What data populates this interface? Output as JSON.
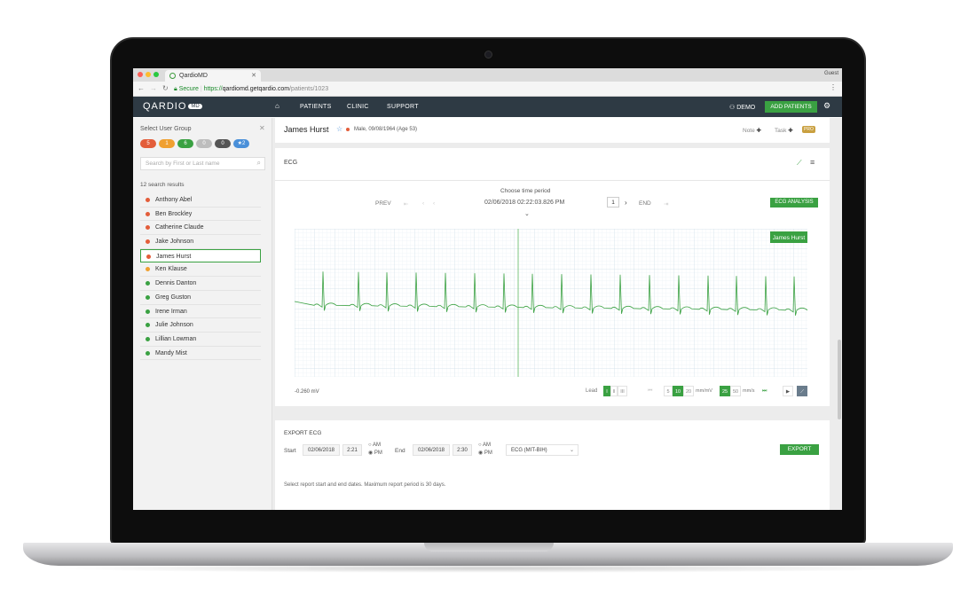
{
  "browser": {
    "tab_title": "QardioMD",
    "profile": "Guest",
    "secure_label": "Secure",
    "url_scheme": "https://",
    "url_host": "qardiomd.getqardio.com",
    "url_path": "/patients/1023"
  },
  "app": {
    "logo": "QARDIO",
    "logo_badge": "MD",
    "nav": [
      "PATIENTS",
      "CLINIC",
      "SUPPORT"
    ],
    "demo_label": "DEMO",
    "add_patients_label": "ADD PATIENTS"
  },
  "sidebar": {
    "title": "Select User Group",
    "badges": [
      {
        "label": "5",
        "color": "#e35d3a"
      },
      {
        "label": "1",
        "color": "#f0a030"
      },
      {
        "label": "6",
        "color": "#3aa142"
      },
      {
        "label": "0",
        "color": "#bdbdbd"
      },
      {
        "label": "0",
        "color": "#555555"
      },
      {
        "label": "★2",
        "color": "#4a90d9"
      }
    ],
    "search_placeholder": "Search by First or Last name",
    "results_count": "12 search results",
    "patients": [
      {
        "name": "Anthony Abel",
        "status": "#e35d3a"
      },
      {
        "name": "Ben Brockley",
        "status": "#e35d3a"
      },
      {
        "name": "Catherine Claude",
        "status": "#e35d3a"
      },
      {
        "name": "Jake Johnson",
        "status": "#e35d3a"
      },
      {
        "name": "James Hurst",
        "status": "#e35d3a"
      },
      {
        "name": "Ken Klause",
        "status": "#f0a030"
      },
      {
        "name": "Dennis Danton",
        "status": "#3aa142"
      },
      {
        "name": "Greg Guston",
        "status": "#3aa142"
      },
      {
        "name": "Irene Irman",
        "status": "#3aa142"
      },
      {
        "name": "Julie Johnson",
        "status": "#3aa142"
      },
      {
        "name": "Lillian Lowman",
        "status": "#3aa142"
      },
      {
        "name": "Mandy Mist",
        "status": "#3aa142"
      }
    ],
    "selected_patient": "James Hurst"
  },
  "patient": {
    "name": "James Hurst",
    "meta": "Male, 09/08/1964 (Age 53)",
    "note_label": "Note",
    "task_label": "Task",
    "pro_label": "PRO"
  },
  "ecg": {
    "title": "ECG",
    "choose_label": "Choose time period",
    "prev_label": "PREV",
    "datetime": "02/06/2018 02:22:03.826 PM",
    "page": "1",
    "end_label": "END",
    "analysis_label": "ECG ANALYSIS",
    "trace_label": "James Hurst",
    "amplitude": "-0.260 mV",
    "lead_label": "Lead",
    "leads": [
      "I",
      "II",
      "III"
    ],
    "selected_lead": "I",
    "gain_options": [
      "5",
      "10",
      "20"
    ],
    "gain_selected": "10",
    "gain_unit": "mm/mV",
    "speed_options": [
      "25",
      "50"
    ],
    "speed_selected": "25",
    "speed_unit": "mm/s"
  },
  "export": {
    "title": "EXPORT ECG",
    "start_label": "Start",
    "start_date": "02/06/2018",
    "start_time": "2:21",
    "end_label": "End",
    "end_date": "02/06/2018",
    "end_time": "2:30",
    "am_label": "AM",
    "pm_label": "PM",
    "format": "ECG (MIT-BIH)",
    "export_label": "EXPORT",
    "note": "Select report start and end dates. Maximum report period is 30 days."
  }
}
